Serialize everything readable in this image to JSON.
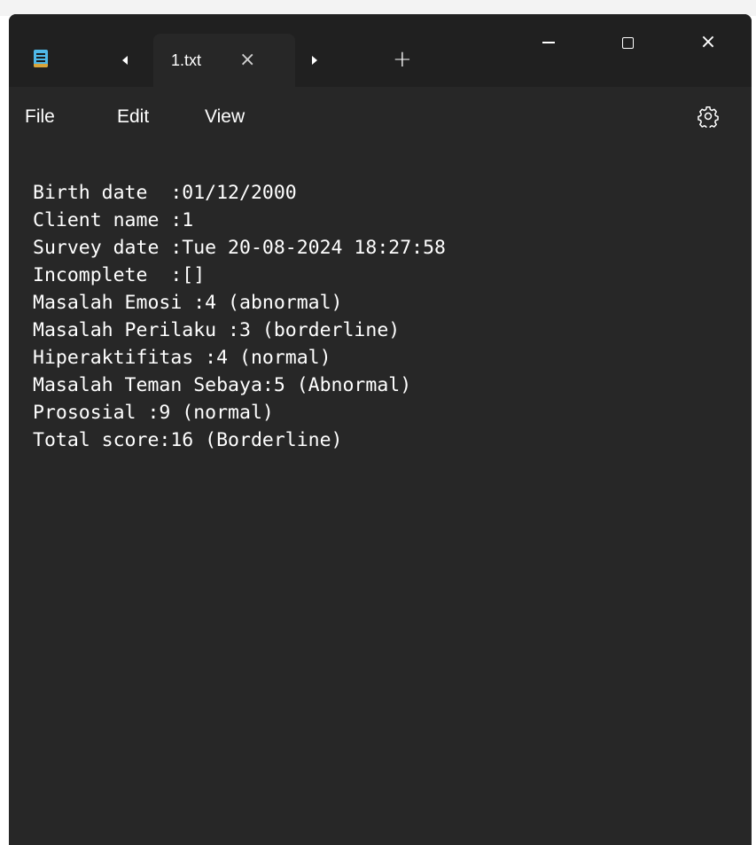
{
  "window": {
    "tab_title": "1.txt",
    "tab_close_glyph": "×",
    "new_tab_glyph": "+",
    "close_glyph": "×"
  },
  "icons": {
    "app": "notepad-icon",
    "scroll_left": "caret-left-icon",
    "scroll_right": "caret-right-icon",
    "tab_close": "close-icon",
    "new_tab": "plus-icon",
    "minimize": "minimize-icon",
    "maximize": "maximize-icon",
    "close": "close-icon",
    "settings": "gear-icon"
  },
  "colors": {
    "titlebar_bg": "#202020",
    "editor_bg": "#272727",
    "text": "#ffffff",
    "app_icon": "#4fb8e8"
  },
  "menu": {
    "file": "File",
    "edit": "Edit",
    "view": "View"
  },
  "document": {
    "lines": [
      "Birth date  :01/12/2000",
      "Client name :1",
      "Survey date :Tue 20-08-2024 18:27:58",
      "Incomplete  :[]",
      "Masalah Emosi :4 (abnormal)",
      "Masalah Perilaku :3 (borderline)",
      "Hiperaktifitas :4 (normal)",
      "Masalah Teman Sebaya:5 (Abnormal)",
      "Prososial :9 (normal)",
      "Total score:16 (Borderline)"
    ]
  }
}
